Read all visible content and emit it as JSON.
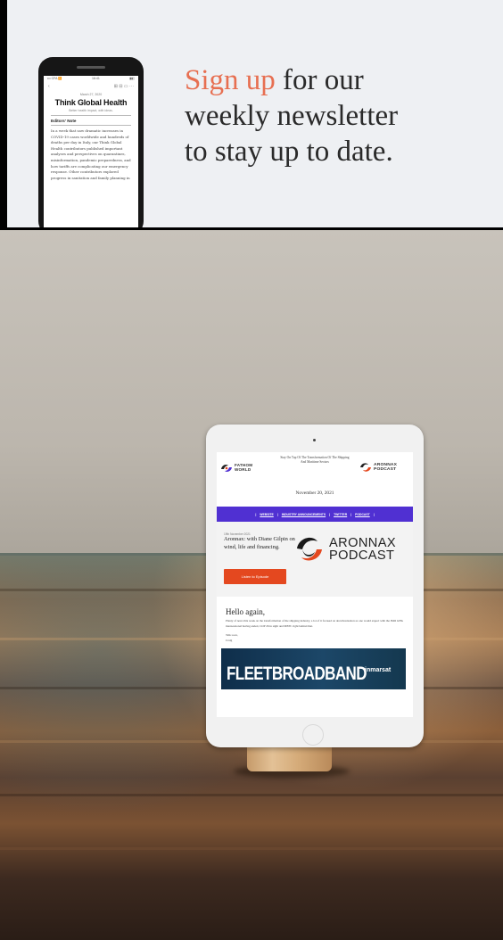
{
  "banner": {
    "headline_accent": "Sign up",
    "headline_line1_rest": " for our",
    "headline_line2": "weekly newsletter",
    "headline_line3": "to stay up to date.",
    "accent_color": "#e76f51",
    "phone": {
      "status_carrier": "••• CFA 🛜",
      "status_time": "16:41",
      "status_battery": "▮▮▯",
      "toolbar_back": "‹",
      "toolbar_tools": "⊞ ⊟ ▭ ···",
      "date": "March 27, 2020",
      "title": "Think Global Health",
      "tagline": "Better health impact, with ideas.",
      "section": "Editors' Note",
      "body": "In a week that saw dramatic increases in COVID-19 cases worldwide and hundreds of deaths per day in Italy, our Think Global Health contributors published important analyses and perspectives on quarantines, misinformation, pandemic preparedness, and how tariffs are complicating our emergency response. Other contributors explored progress in sanitation and family planning in"
    }
  },
  "email": {
    "fathom_logo": "FATHOM\nWORLD",
    "tagline": "Stay On Top Of The Transformation Of The Shipping And Maritime Sectors",
    "aronnax_logo_small": "ARONNAX\nPODCAST",
    "date": "November 20, 2021",
    "nav": [
      "WEBSITE",
      "INDUSTRY ANNOUNCEMENTS",
      "TWITTER",
      "PODCAST"
    ],
    "nav_color": "#5030d2",
    "feature_date": "19th November 2021",
    "feature_title": "Aronnax: with Diane Gilpin on wind, life and financing.",
    "aronnax_logo_big_line1": "ARONNAX",
    "aronnax_logo_big_line2": "PODCAST",
    "button_label": "Listen to Episode",
    "button_color": "#e4481f",
    "greeting": "Hello again,",
    "body": "Plenty of news this week on the transformation of the shipping industry, a lot of it focused on decarbonisation as one would expect with the IMO GHG intersessional having ended, COP 26 in sight and MEPC right behind that.",
    "sign_off_1": "Talk soon,",
    "sign_off_2": "Craig",
    "ad_brand": "FLEETBROADBAND",
    "ad_partner": "inmarsat"
  }
}
